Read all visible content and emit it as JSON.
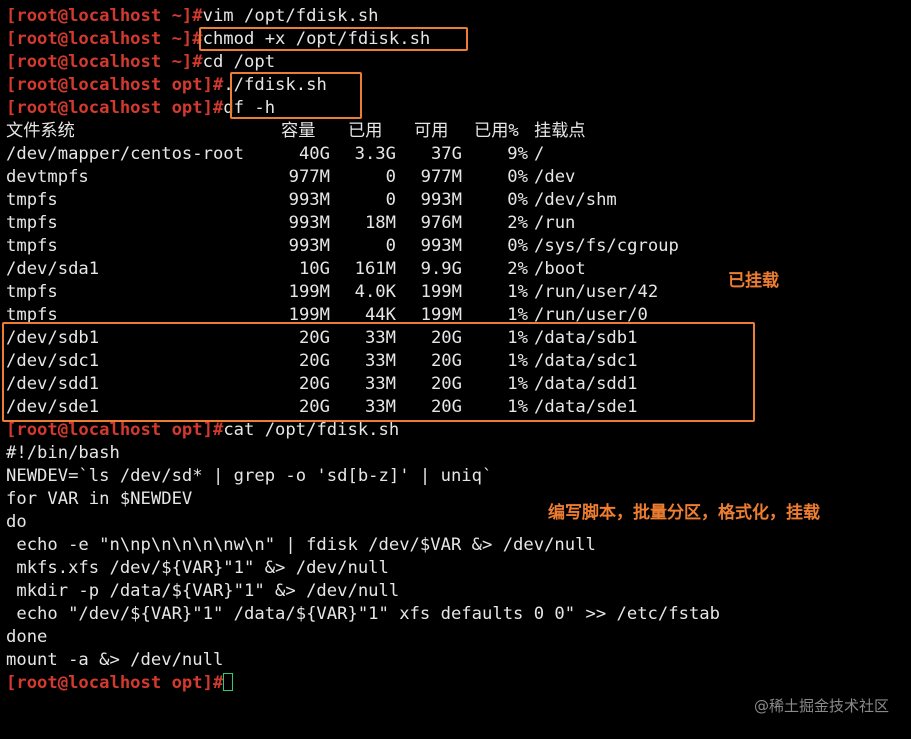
{
  "history": [
    {
      "prompt": "[root@localhost ~]#",
      "command": "vim /opt/fdisk.sh"
    },
    {
      "prompt": "[root@localhost ~]#",
      "command": "chmod +x /opt/fdisk.sh"
    },
    {
      "prompt": "[root@localhost ~]#",
      "command": "cd /opt"
    },
    {
      "prompt": "[root@localhost opt]#",
      "command": "./fdisk.sh"
    },
    {
      "prompt": "[root@localhost opt]#",
      "command": "df -h"
    }
  ],
  "df": {
    "headers": [
      "文件系统",
      "容量",
      "已用",
      "可用",
      "已用%",
      "挂载点"
    ],
    "rows": [
      [
        "/dev/mapper/centos-root",
        "40G",
        "3.3G",
        "37G",
        "9%",
        "/"
      ],
      [
        "devtmpfs",
        "977M",
        "0",
        "977M",
        "0%",
        "/dev"
      ],
      [
        "tmpfs",
        "993M",
        "0",
        "993M",
        "0%",
        "/dev/shm"
      ],
      [
        "tmpfs",
        "993M",
        "18M",
        "976M",
        "2%",
        "/run"
      ],
      [
        "tmpfs",
        "993M",
        "0",
        "993M",
        "0%",
        "/sys/fs/cgroup"
      ],
      [
        "/dev/sda1",
        "10G",
        "161M",
        "9.9G",
        "2%",
        "/boot"
      ],
      [
        "tmpfs",
        "199M",
        "4.0K",
        "199M",
        "1%",
        "/run/user/42"
      ],
      [
        "tmpfs",
        "199M",
        "44K",
        "199M",
        "1%",
        "/run/user/0"
      ],
      [
        "/dev/sdb1",
        "20G",
        "33M",
        "20G",
        "1%",
        "/data/sdb1"
      ],
      [
        "/dev/sdc1",
        "20G",
        "33M",
        "20G",
        "1%",
        "/data/sdc1"
      ],
      [
        "/dev/sdd1",
        "20G",
        "33M",
        "20G",
        "1%",
        "/data/sdd1"
      ],
      [
        "/dev/sde1",
        "20G",
        "33M",
        "20G",
        "1%",
        "/data/sde1"
      ]
    ]
  },
  "cat_command": {
    "prompt": "[root@localhost opt]#",
    "command": "cat /opt/fdisk.sh"
  },
  "script_lines": [
    "#!/bin/bash",
    "NEWDEV=`ls /dev/sd* | grep -o 'sd[b-z]' | uniq`",
    "for VAR in $NEWDEV",
    "do",
    " echo -e \"n\\np\\n\\n\\n\\nw\\n\" | fdisk /dev/$VAR &> /dev/null",
    " mkfs.xfs /dev/${VAR}\"1\" &> /dev/null",
    " mkdir -p /data/${VAR}\"1\" &> /dev/null",
    " echo \"/dev/${VAR}\"1\" /data/${VAR}\"1\" xfs defaults 0 0\" >> /etc/fstab",
    "done",
    "mount -a &> /dev/null"
  ],
  "final_prompt": "[root@localhost opt]#",
  "annotations": {
    "mounted": "已挂载",
    "script_note": "编写脚本，批量分区，格式化，挂载"
  },
  "watermark": "@稀土掘金技术社区",
  "colors": {
    "background": "#000000",
    "text": "#e6e6e6",
    "prompt": "#d2392f",
    "highlight": "#ed7d31",
    "cursor": "#2ecc71"
  }
}
